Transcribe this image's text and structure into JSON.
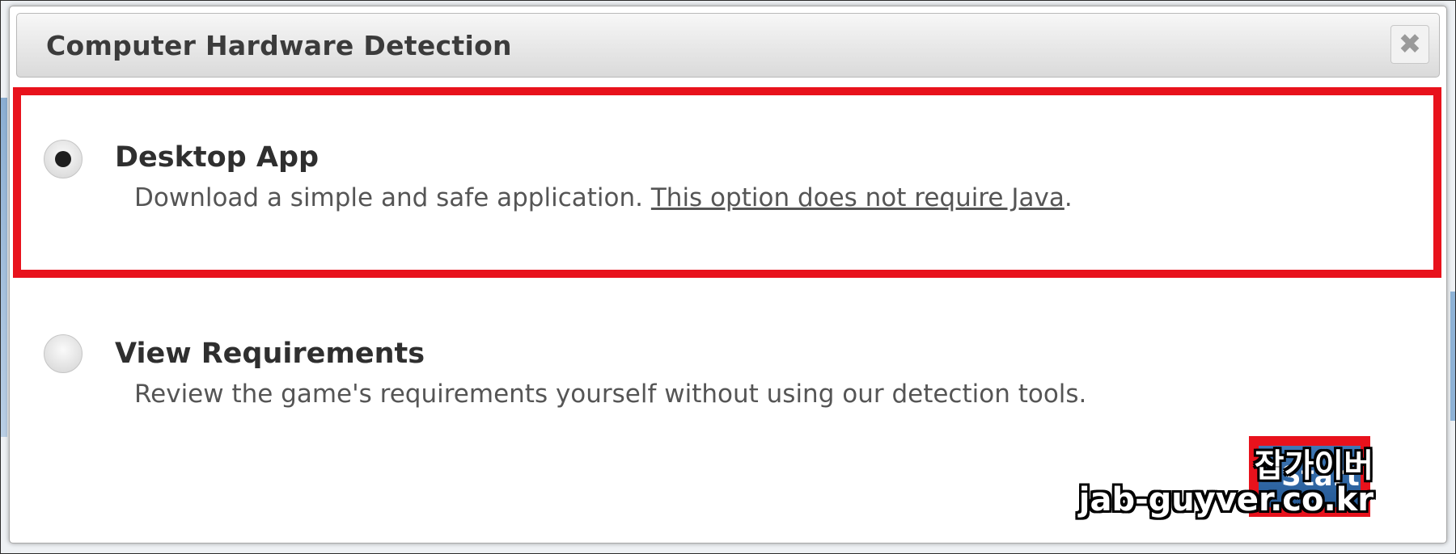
{
  "dialog": {
    "title": "Computer Hardware Detection",
    "close_icon": "close-icon",
    "close_glyph": "✖"
  },
  "options": [
    {
      "label": "Desktop App",
      "description": "Download a simple and safe application. ",
      "link_text": "This option does not require Java",
      "trailing": ".",
      "selected": true
    },
    {
      "label": "View Requirements",
      "description": "Review the game's requirements yourself without using our detection tools.",
      "selected": false
    }
  ],
  "start_button": {
    "label": "Start"
  },
  "watermark": {
    "line1": "잡가이버",
    "line2": "jab-guyver.co.kr"
  },
  "colors": {
    "highlight": "#e8121c",
    "button": "#2f6aa8"
  }
}
